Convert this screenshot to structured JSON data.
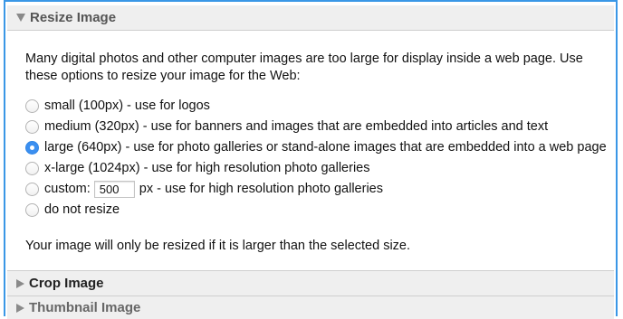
{
  "panels": {
    "resize_title": "Resize Image",
    "crop_title": "Crop Image",
    "thumbnail_title": "Thumbnail Image"
  },
  "resize": {
    "intro": "Many digital photos and other computer images are too large for display inside a web page. Use these options to resize your image for the Web:",
    "options": [
      {
        "label": "small (100px) - use for logos",
        "checked": false
      },
      {
        "label": "medium (320px) - use for banners and images that are embedded into articles and text",
        "checked": false
      },
      {
        "label": "large (640px) - use for photo galleries or stand-alone images that are embedded into a web page",
        "checked": true
      },
      {
        "label": "x-large (1024px) - use for high resolution photo galleries",
        "checked": false
      }
    ],
    "custom": {
      "prefix": "custom:",
      "value": "500",
      "suffix": "px - use for high resolution photo galleries",
      "checked": false
    },
    "no_resize": {
      "label": "do not resize",
      "checked": false
    },
    "note": "Your image will only be resized if it is larger than the selected size."
  },
  "colors": {
    "frame_border": "#3a97e6",
    "header_bg": "#efefef",
    "radio_selected": "#3b8ff0"
  }
}
